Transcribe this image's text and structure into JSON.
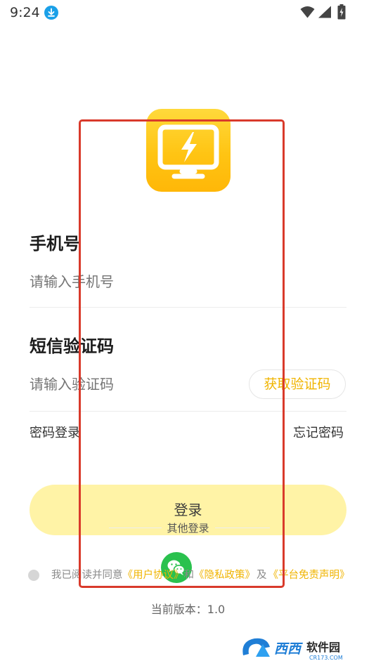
{
  "status_bar": {
    "time": "9:24",
    "icons": [
      "download-icon",
      "wifi-icon",
      "signal-icon",
      "battery-icon"
    ]
  },
  "colors": {
    "accent": "#F0B400",
    "login_button_bg": "#FFF3A6",
    "logo_yellow": "#FFC413",
    "wechat_green": "#2AC14E",
    "highlight_red": "#D93A2B"
  },
  "logo": {
    "icon": "lightning-monitor-icon"
  },
  "form": {
    "phone_title": "手机号",
    "phone_placeholder": "请输入手机号",
    "code_title": "短信验证码",
    "code_placeholder": "请输入验证码",
    "get_code_label": "获取验证码",
    "password_login_label": "密码登录",
    "forgot_password_label": "忘记密码"
  },
  "login_button": {
    "label": "登录"
  },
  "other_login": {
    "label": "其他登录",
    "icon": "wechat-icon"
  },
  "agreement": {
    "prefix": "我已阅读并同意",
    "user_agreement": "《用户协议》",
    "and": "和",
    "privacy_policy": "《隐私政策》",
    "and2": "及",
    "disclaimer": "《平台免责声明》"
  },
  "version": {
    "text": "当前版本：1.0"
  },
  "watermark": {
    "brand": "西西软件园",
    "domain": "CR173.COM"
  }
}
